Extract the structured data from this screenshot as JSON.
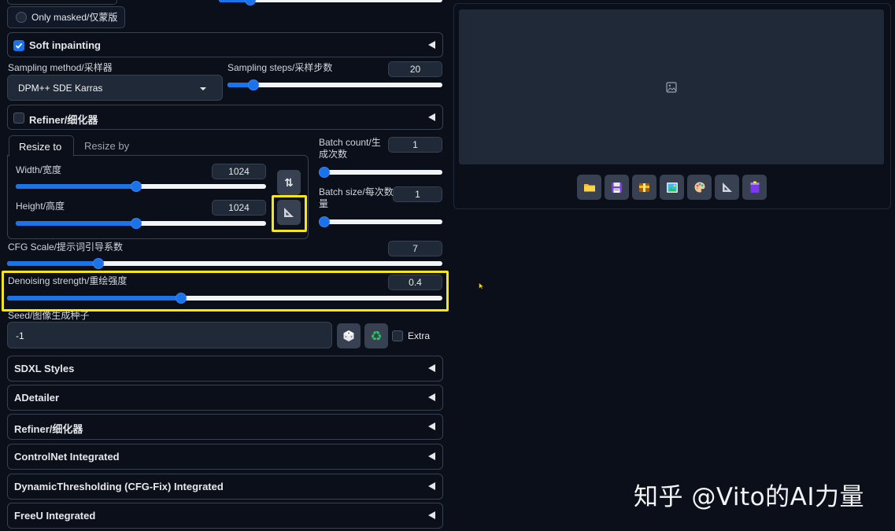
{
  "mask_mode": {
    "only_masked_label": "Only masked/仅蒙版"
  },
  "soft_inpainting": {
    "label": "Soft inpainting",
    "checked": true
  },
  "sampling": {
    "method_label": "Sampling method/采样器",
    "method_value": "DPM++ SDE Karras",
    "steps_label": "Sampling steps/采样步数",
    "steps_value": "20",
    "steps_fraction": 0.12
  },
  "refiner_top": {
    "label": "Refiner/细化器",
    "checked": false
  },
  "resize": {
    "tabs": [
      "Resize to",
      "Resize by"
    ],
    "active_tab": 0,
    "width_label": "Width/宽度",
    "width_value": "1024",
    "width_fraction": 0.48,
    "height_label": "Height/高度",
    "height_value": "1024",
    "height_fraction": 0.48,
    "swap_icon": "swap-arrows-icon",
    "ratio_icon": "triangle-ruler-icon"
  },
  "batch": {
    "count_label": "Batch count/生成次数",
    "count_value": "1",
    "count_fraction": 0.0,
    "size_label": "Batch size/每次数量",
    "size_value": "1",
    "size_fraction": 0.0
  },
  "cfg": {
    "label": "CFG Scale/提示词引导系数",
    "value": "7",
    "fraction": 0.21
  },
  "denoise": {
    "label": "Denoising strength/重绘强度",
    "value": "0.4",
    "fraction": 0.4
  },
  "seed": {
    "label": "Seed/图像生成种子",
    "value": "-1",
    "dice_icon": "dice-icon",
    "recycle_icon": "recycle-icon",
    "extra_label": "Extra"
  },
  "accordions": [
    "SDXL Styles",
    "ADetailer",
    "Refiner/细化器",
    "ControlNet Integrated",
    "DynamicThresholding (CFG-Fix) Integrated",
    "FreeU Integrated"
  ],
  "output": {
    "placeholder_icon": "image-icon",
    "toolbar_icons": [
      "folder-icon",
      "save-icon",
      "zip-icon",
      "send-to-img2img-icon",
      "palette-icon",
      "triangle-ruler-icon",
      "extras-icon"
    ]
  },
  "watermark": "知乎 @Vito的AI力量",
  "colors": {
    "accent": "#1a73e8",
    "highlight": "#f5e614",
    "background": "#0b0f19",
    "panel": "#1f2937"
  }
}
